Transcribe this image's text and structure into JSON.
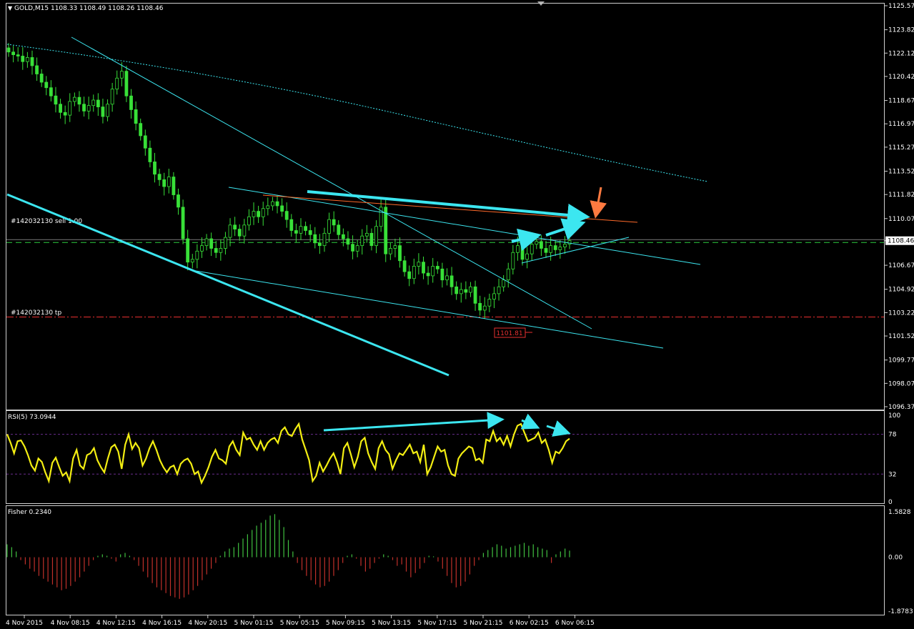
{
  "chart_data": [
    {
      "type": "candlestick",
      "title": "GOLD,M15  1108.33 1108.49 1108.26 1108.46",
      "ylim": [
        1096.37,
        1125.57
      ],
      "y_ticks": [
        "1125.57",
        "1123.82",
        "1122.12",
        "1120.42",
        "1118.67",
        "1116.97",
        "1115.27",
        "1113.52",
        "1111.82",
        "1110.07",
        "1108.46",
        "1106.67",
        "1104.92",
        "1103.22",
        "1101.52",
        "1099.77",
        "1098.07",
        "1096.37"
      ],
      "current_price": "1108.46",
      "order_lines": [
        {
          "label": "#142032130 sell 1.00",
          "price": 1108.33,
          "color": "#2ecc40"
        },
        {
          "label": "#142032130 tp",
          "price": 1102.9,
          "color": "#e83030"
        }
      ],
      "price_tag": "1101.81",
      "closes": [
        1122.2,
        1122.0,
        1121.9,
        1121.5,
        1121.8,
        1121.2,
        1120.6,
        1120.0,
        1119.6,
        1119.0,
        1118.4,
        1117.8,
        1117.6,
        1118.6,
        1118.9,
        1118.4,
        1117.9,
        1118.3,
        1118.7,
        1118.2,
        1117.5,
        1118.4,
        1119.5,
        1120.3,
        1120.8,
        1119.0,
        1118.0,
        1117.0,
        1116.1,
        1115.2,
        1114.2,
        1113.3,
        1112.9,
        1112.4,
        1113.1,
        1111.8,
        1110.9,
        1108.6,
        1106.9,
        1107.1,
        1107.7,
        1108.1,
        1108.6,
        1107.9,
        1107.6,
        1107.9,
        1108.7,
        1109.6,
        1109.3,
        1108.8,
        1109.6,
        1110.2,
        1110.6,
        1110.2,
        1110.8,
        1111.0,
        1111.3,
        1111.0,
        1110.6,
        1110.0,
        1109.2,
        1109.0,
        1109.5,
        1109.2,
        1108.9,
        1108.3,
        1108.1,
        1109.0,
        1110.0,
        1109.6,
        1108.9,
        1108.6,
        1108.2,
        1107.7,
        1108.1,
        1108.8,
        1109.0,
        1108.1,
        1109.5,
        1110.9,
        1107.5,
        1107.9,
        1108.1,
        1107.0,
        1106.2,
        1105.7,
        1106.6,
        1106.9,
        1106.1,
        1105.9,
        1106.6,
        1106.4,
        1105.6,
        1105.9,
        1105.1,
        1104.6,
        1104.9,
        1104.7,
        1105.1,
        1103.9,
        1103.4,
        1103.7,
        1104.2,
        1104.6,
        1105.1,
        1105.6,
        1106.4,
        1107.6,
        1108.1,
        1107.1,
        1107.5,
        1108.2,
        1108.4,
        1107.9,
        1107.6,
        1108.1,
        1107.8,
        1108.0,
        1108.2,
        1108.46
      ]
    },
    {
      "type": "line",
      "title": "RSI(5) 73.0944",
      "ylim": [
        0,
        100
      ],
      "y_ticks": [
        "100",
        "78",
        "32",
        "0"
      ],
      "levels": [
        78,
        32
      ],
      "values": [
        78,
        68,
        56,
        70,
        71,
        64,
        54,
        42,
        36,
        50,
        46,
        34,
        24,
        45,
        51,
        40,
        30,
        34,
        24,
        50,
        60,
        42,
        38,
        54,
        56,
        62,
        48,
        40,
        34,
        50,
        63,
        66,
        58,
        38,
        66,
        78,
        61,
        68,
        62,
        42,
        50,
        62,
        70,
        60,
        48,
        40,
        34,
        40,
        42,
        32,
        44,
        48,
        50,
        44,
        32,
        35,
        22,
        30,
        40,
        52,
        60,
        50,
        48,
        44,
        64,
        70,
        60,
        54,
        80,
        72,
        74,
        66,
        60,
        70,
        60,
        68,
        72,
        74,
        68,
        82,
        86,
        78,
        76,
        84,
        90,
        72,
        60,
        48,
        24,
        30,
        45,
        35,
        42,
        50,
        56,
        46,
        32,
        62,
        68,
        55,
        40,
        52,
        70,
        74,
        56,
        46,
        38,
        62,
        70,
        60,
        55,
        38,
        48,
        56,
        54,
        60,
        66,
        56,
        58,
        46,
        66,
        32,
        40,
        52,
        64,
        58,
        60,
        42,
        32,
        30,
        50,
        56,
        60,
        64,
        62,
        48,
        50,
        45,
        72,
        70,
        82,
        70,
        74,
        66,
        76,
        64,
        78,
        88,
        90,
        80,
        70,
        72,
        74,
        80,
        68,
        72,
        60,
        45,
        58,
        56,
        62,
        70,
        73.09
      ],
      "value_label": "73.0944"
    },
    {
      "type": "bar",
      "title": "Fisher 0.2340",
      "ylim": [
        -1.8783,
        1.5828
      ],
      "y_ticks": [
        "1.5828",
        "0.00",
        "-1.8783"
      ],
      "values": [
        0.45,
        0.35,
        0.2,
        -0.1,
        -0.25,
        -0.4,
        -0.5,
        -0.65,
        -0.75,
        -0.85,
        -0.95,
        -1.05,
        -1.15,
        -1.1,
        -1.0,
        -0.85,
        -0.7,
        -0.5,
        -0.3,
        -0.1,
        0.05,
        0.1,
        0.05,
        -0.05,
        -0.15,
        0.1,
        0.15,
        0.05,
        -0.1,
        -0.3,
        -0.5,
        -0.7,
        -0.9,
        -1.05,
        -1.15,
        -1.25,
        -1.35,
        -1.4,
        -1.45,
        -1.4,
        -1.3,
        -1.15,
        -1.0,
        -0.8,
        -0.6,
        -0.4,
        -0.2,
        0.05,
        0.2,
        0.3,
        0.35,
        0.5,
        0.65,
        0.8,
        0.95,
        1.1,
        1.2,
        1.3,
        1.45,
        1.5,
        1.3,
        1.05,
        0.6,
        0.2,
        -0.2,
        -0.45,
        -0.65,
        -0.8,
        -0.95,
        -1.05,
        -1.0,
        -0.85,
        -0.65,
        -0.45,
        -0.2,
        0.05,
        0.1,
        -0.05,
        -0.3,
        -0.5,
        -0.4,
        -0.2,
        -0.05,
        0.1,
        0.05,
        -0.1,
        -0.3,
        -0.25,
        -0.5,
        -0.7,
        -0.55,
        -0.4,
        -0.2,
        0.05,
        0.03,
        -0.15,
        -0.4,
        -0.65,
        -0.9,
        -1.05,
        -1.0,
        -0.85,
        -0.6,
        -0.3,
        -0.1,
        0.15,
        0.25,
        0.35,
        0.45,
        0.4,
        0.3,
        0.35,
        0.4,
        0.45,
        0.5,
        0.4,
        0.45,
        0.35,
        0.3,
        0.25,
        -0.2,
        0.1,
        0.2,
        0.3,
        0.23
      ]
    }
  ],
  "x_labels": [
    "4 Nov 2015",
    "4 Nov 08:15",
    "4 Nov 12:15",
    "4 Nov 16:15",
    "4 Nov 20:15",
    "5 Nov 01:15",
    "5 Nov 05:15",
    "5 Nov 09:15",
    "5 Nov 13:15",
    "5 Nov 17:15",
    "5 Nov 21:15",
    "6 Nov 02:15",
    "6 Nov 06:15"
  ],
  "colors": {
    "background": "#000000",
    "candle": "#38e038",
    "rsi": "#f3ee12",
    "fisher_pos": "#40c040",
    "fisher_neg": "#c0302a",
    "trend_cyan": "#3ce6f0",
    "trend_orange": "#ff6a2a",
    "arrow_orange": "#ff7a40"
  }
}
